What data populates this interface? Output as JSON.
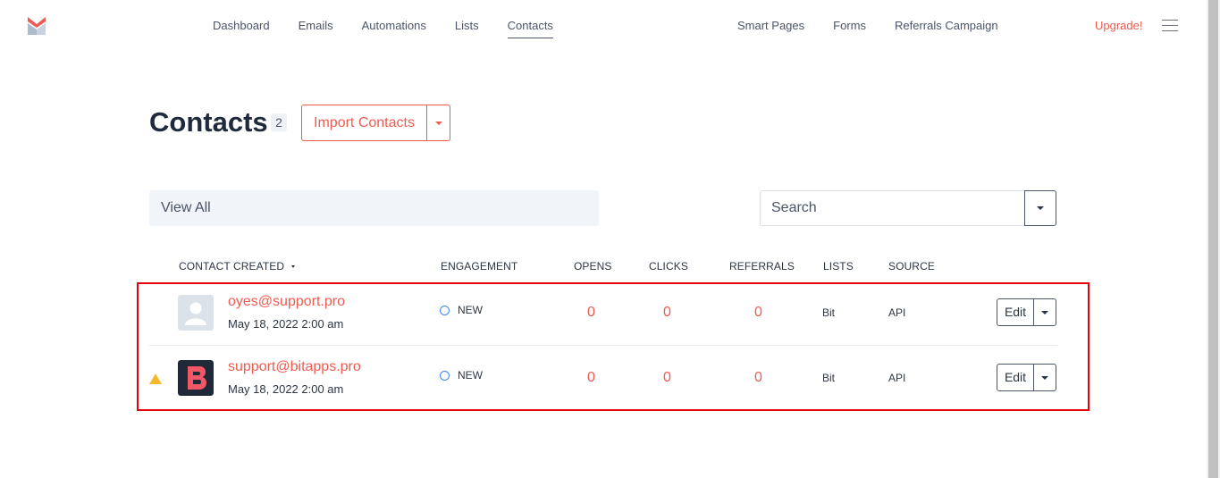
{
  "nav": {
    "left": [
      "Dashboard",
      "Emails",
      "Automations",
      "Lists",
      "Contacts"
    ],
    "right": [
      "Smart Pages",
      "Forms",
      "Referrals Campaign"
    ],
    "upgrade": "Upgrade!"
  },
  "header": {
    "title": "Contacts",
    "count": "2",
    "import_label": "Import Contacts"
  },
  "filters": {
    "view_all": "View All",
    "search_placeholder": "Search"
  },
  "table": {
    "headers": [
      "CONTACT CREATED",
      "ENGAGEMENT",
      "OPENS",
      "CLICKS",
      "REFERRALS",
      "LISTS",
      "SOURCE"
    ],
    "rows": [
      {
        "email": "oyes@support.pro",
        "date": "May 18, 2022 2:00 am",
        "engagement": "NEW",
        "opens": "0",
        "clicks": "0",
        "referrals": "0",
        "lists": "Bit",
        "source": "API",
        "edit": "Edit",
        "avatar": "default-user-avatar"
      },
      {
        "email": "support@bitapps.pro",
        "date": "May 18, 2022 2:00 am",
        "engagement": "NEW",
        "opens": "0",
        "clicks": "0",
        "referrals": "0",
        "lists": "Bit",
        "source": "API",
        "edit": "Edit",
        "avatar": "bitapps-logo",
        "warning": true
      }
    ]
  },
  "colors": {
    "accent": "#ef5b50",
    "highlight": "#e3000f",
    "engagement_dot": "#3b82f6",
    "warning": "#f5b82e"
  }
}
